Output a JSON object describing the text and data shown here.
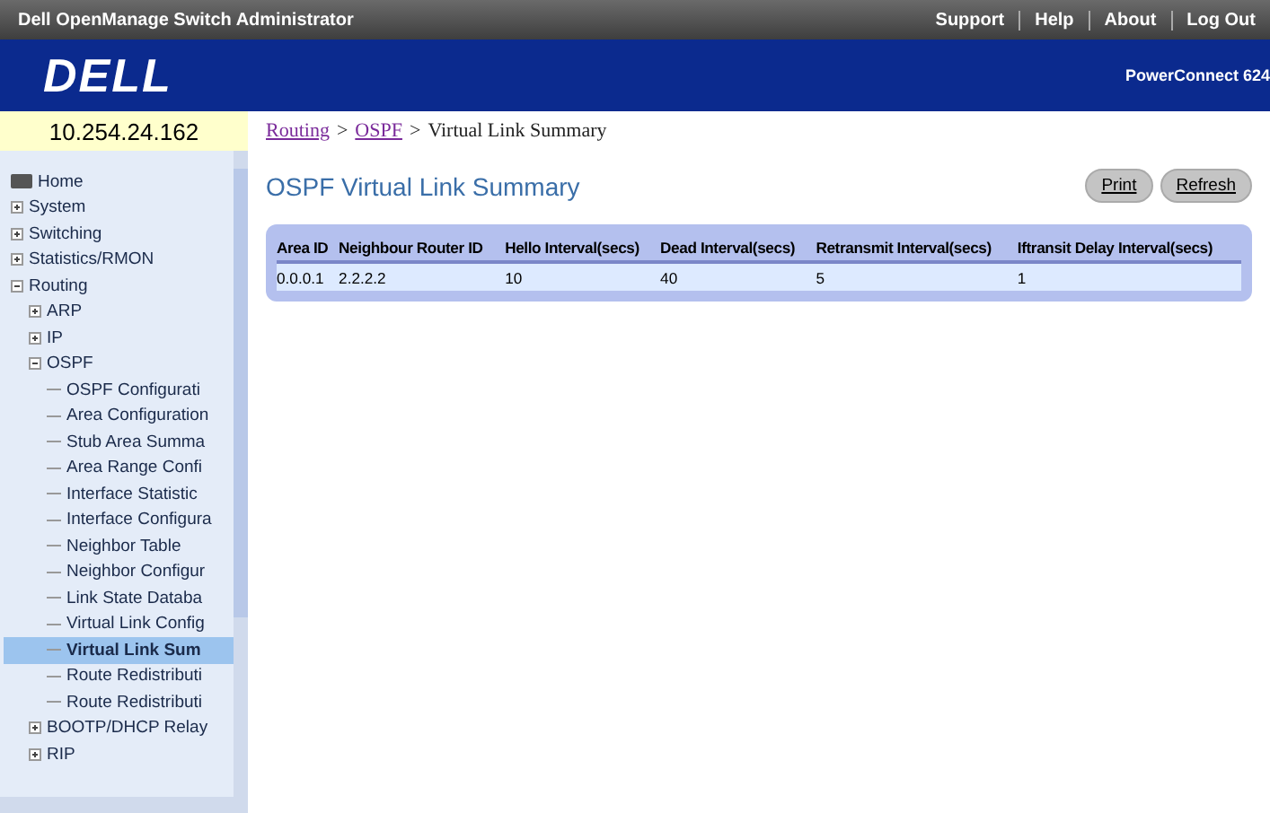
{
  "window": {
    "title": "Dell OpenManage Switch Administrator"
  },
  "top_links": [
    "Support",
    "Help",
    "About",
    "Log Out"
  ],
  "banner": {
    "logo": "DELL",
    "product": "PowerConnect 624"
  },
  "ip_address": "10.254.24.162",
  "breadcrumb": [
    {
      "label": "Routing",
      "kind": "link"
    },
    {
      "label": ">",
      "kind": "sep"
    },
    {
      "label": "OSPF",
      "kind": "link"
    },
    {
      "label": ">",
      "kind": "sep"
    },
    {
      "label": "Virtual Link Summary",
      "kind": "text"
    }
  ],
  "tree": [
    {
      "label": "Home",
      "kind": "home",
      "selected": false
    },
    {
      "label": "System",
      "kind": "folder",
      "expanded": false,
      "selected": false
    },
    {
      "label": "Switching",
      "kind": "folder",
      "expanded": false,
      "selected": false
    },
    {
      "label": "Statistics/RMON",
      "kind": "folder",
      "expanded": false,
      "selected": false
    },
    {
      "label": "Routing",
      "kind": "folder",
      "expanded": true,
      "selected": false,
      "children": [
        {
          "label": "ARP",
          "kind": "folder",
          "expanded": false,
          "selected": false
        },
        {
          "label": "IP",
          "kind": "folder",
          "expanded": false,
          "selected": false
        },
        {
          "label": "OSPF",
          "kind": "folder",
          "expanded": true,
          "selected": false,
          "children": [
            {
              "label": "OSPF Configurati",
              "kind": "page",
              "selected": false
            },
            {
              "label": "Area Configuration",
              "kind": "page",
              "selected": false
            },
            {
              "label": "Stub Area Summa",
              "kind": "page",
              "selected": false
            },
            {
              "label": "Area Range Confi",
              "kind": "page",
              "selected": false
            },
            {
              "label": "Interface Statistic",
              "kind": "page",
              "selected": false
            },
            {
              "label": "Interface Configura",
              "kind": "page",
              "selected": false
            },
            {
              "label": "Neighbor Table",
              "kind": "page",
              "selected": false
            },
            {
              "label": "Neighbor Configur",
              "kind": "page",
              "selected": false
            },
            {
              "label": "Link State Databa",
              "kind": "page",
              "selected": false
            },
            {
              "label": "Virtual Link Config",
              "kind": "page",
              "selected": false
            },
            {
              "label": "Virtual Link Sum",
              "kind": "page",
              "selected": true
            },
            {
              "label": "Route Redistributi",
              "kind": "page",
              "selected": false
            },
            {
              "label": "Route Redistributi",
              "kind": "page",
              "selected": false
            }
          ]
        },
        {
          "label": "BOOTP/DHCP Relay",
          "kind": "folder",
          "expanded": false,
          "selected": false
        },
        {
          "label": "RIP",
          "kind": "folder",
          "expanded": false,
          "selected": false
        }
      ]
    }
  ],
  "page_title": "OSPF Virtual Link Summary",
  "buttons": [
    "Print",
    "Refresh"
  ],
  "table": {
    "columns": [
      "Area ID",
      "Neighbour Router ID",
      "Hello Interval(secs)",
      "Dead Interval(secs)",
      "Retransmit Interval(secs)",
      "Iftransit Delay Interval(secs)"
    ],
    "rows": [
      [
        "0.0.0.1",
        "2.2.2.2",
        "10",
        "40",
        "5",
        "1"
      ]
    ]
  }
}
